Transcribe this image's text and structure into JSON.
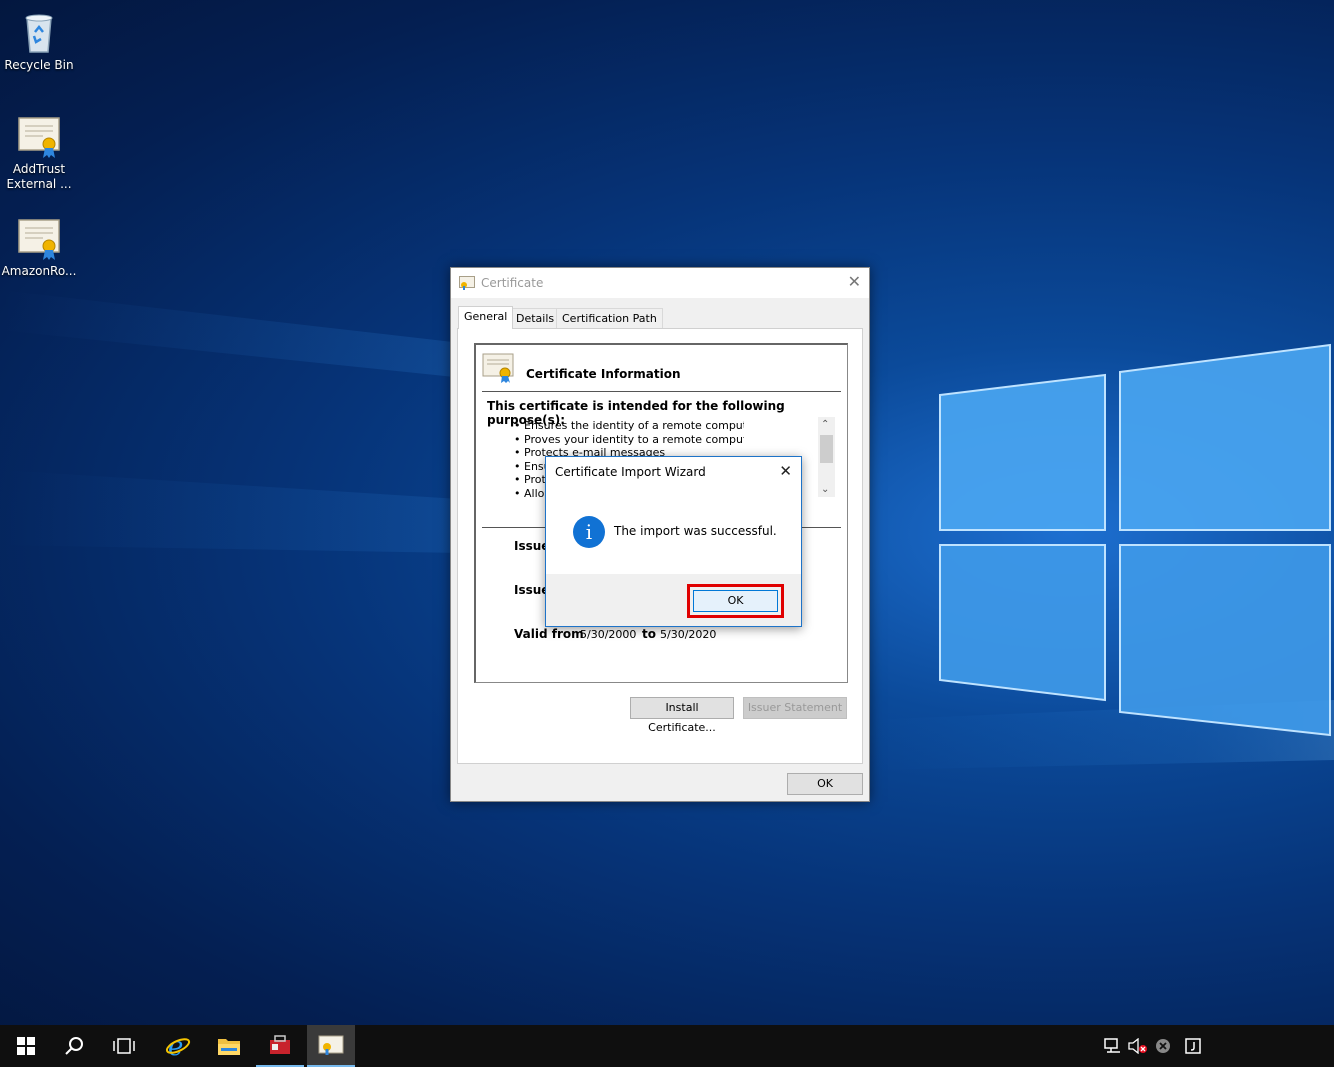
{
  "desktop": {
    "icons": [
      {
        "label": "Recycle Bin",
        "icon": "recycle-bin-icon"
      },
      {
        "label": "AddTrust\nExternal ...",
        "line1": "AddTrust",
        "line2": "External ...",
        "icon": "certificate-icon"
      },
      {
        "label": "AmazonRo...",
        "icon": "certificate-icon"
      }
    ]
  },
  "certificate_window": {
    "title": "Certificate",
    "tabs": [
      "General",
      "Details",
      "Certification Path"
    ],
    "active_tab": "General",
    "info_title": "Certificate Information",
    "purpose_heading": "This certificate is intended for the following purpose(s):",
    "purposes_full": [
      "Ensures the identity of a remote computer",
      "Proves your identity to a remote computer",
      "Protects e-mail messages"
    ],
    "purposes_truncated": [
      "Ensu",
      "Prote",
      "Allow"
    ],
    "issued_to_label": "Issue",
    "issued_by_label": "Issue",
    "valid_from_label": "Valid from",
    "valid_from": "5/30/2000",
    "to_label": "to",
    "valid_to": "5/30/2020",
    "install_button": "Install Certificate...",
    "issuer_statement_button": "Issuer Statement",
    "ok_button": "OK"
  },
  "import_dialog": {
    "title": "Certificate Import Wizard",
    "message": "The import was successful.",
    "ok_button": "OK",
    "icon": "info-icon",
    "highlight_color": "#e00000"
  },
  "taskbar": {
    "items": [
      "start-icon",
      "search-icon",
      "task-view-icon",
      "internet-explorer-icon",
      "file-explorer-icon",
      "server-manager-icon",
      "certificate-app-icon"
    ],
    "tray": [
      "network-icon",
      "volume-muted-icon",
      "error-icon",
      "notification-icon"
    ]
  }
}
